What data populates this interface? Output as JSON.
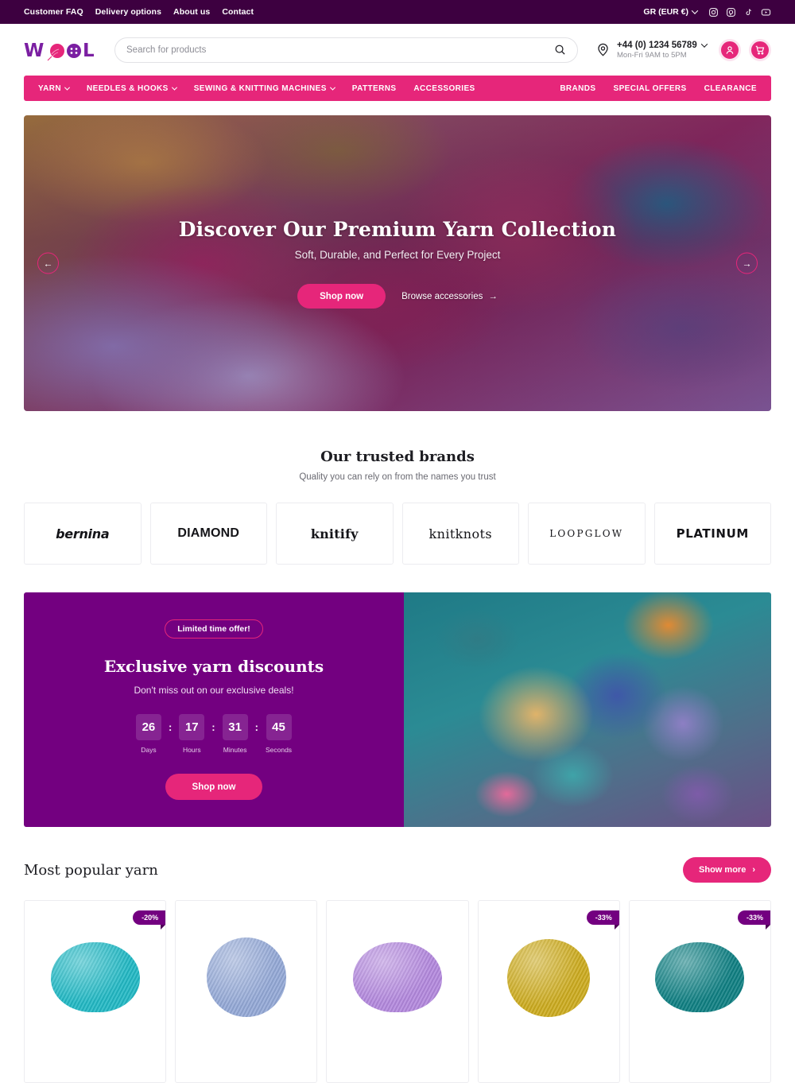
{
  "topbar": {
    "links": [
      "Customer FAQ",
      "Delivery options",
      "About us",
      "Contact"
    ],
    "currency": "GR (EUR €)",
    "social": [
      "instagram-icon",
      "pinterest-icon",
      "tiktok-icon",
      "youtube-icon"
    ]
  },
  "header": {
    "logo_text": "WOOL",
    "search_placeholder": "Search for products",
    "phone": "+44 (0) 1234 56789",
    "hours": "Mon-Fri 9AM to 5PM",
    "account_icon": "user-icon",
    "cart_icon": "cart-icon"
  },
  "nav": {
    "left": [
      {
        "label": "YARN",
        "has_caret": true
      },
      {
        "label": "NEEDLES & HOOKS",
        "has_caret": true
      },
      {
        "label": "SEWING & KNITTING MACHINES",
        "has_caret": true
      },
      {
        "label": "PATTERNS",
        "has_caret": false
      },
      {
        "label": "ACCESSORIES",
        "has_caret": false
      }
    ],
    "right": [
      {
        "label": "BRANDS"
      },
      {
        "label": "SPECIAL OFFERS"
      },
      {
        "label": "CLEARANCE"
      }
    ]
  },
  "hero": {
    "title": "Discover Our Premium Yarn Collection",
    "subtitle": "Soft, Durable, and Perfect for Every Project",
    "primary_cta": "Shop now",
    "secondary_cta": "Browse accessories",
    "prev_arrow": "←",
    "next_arrow": "→"
  },
  "brands": {
    "title": "Our trusted brands",
    "subtitle": "Quality you can rely on from the names you trust",
    "items": [
      {
        "name": "bernina"
      },
      {
        "name": "DIAMOND"
      },
      {
        "name": "knitify"
      },
      {
        "name": "knitknots"
      },
      {
        "name": "LOOPGLOW"
      },
      {
        "name": "PLATINUM"
      }
    ]
  },
  "promo": {
    "badge": "Limited time offer!",
    "title": "Exclusive yarn discounts",
    "subtitle": "Don't miss out on our exclusive deals!",
    "cta": "Shop now",
    "countdown": [
      {
        "value": "26",
        "label": "Days"
      },
      {
        "value": "17",
        "label": "Hours"
      },
      {
        "value": "31",
        "label": "Minutes"
      },
      {
        "value": "45",
        "label": "Seconds"
      }
    ],
    "separator": ":"
  },
  "popular": {
    "title": "Most popular yarn",
    "show_more": "Show more",
    "products": [
      {
        "discount": "-20%",
        "color": "#21b8c4"
      },
      {
        "discount": "",
        "color": "#93a8d6"
      },
      {
        "discount": "",
        "color": "#b388dd"
      },
      {
        "discount": "-33%",
        "color": "#ccab1e"
      },
      {
        "discount": "-33%",
        "color": "#0e7f82"
      }
    ]
  },
  "colors": {
    "brand_purple_dark": "#3d0040",
    "brand_purple": "#730080",
    "brand_pink": "#e6267a"
  }
}
